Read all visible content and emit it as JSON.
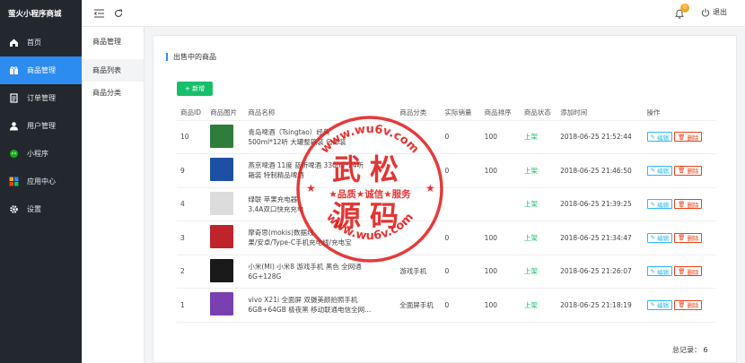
{
  "app": {
    "title": "萤火小程序商城"
  },
  "sidebar": {
    "items": [
      {
        "label": "首页",
        "icon": "home-icon"
      },
      {
        "label": "商品管理",
        "icon": "gift-icon"
      },
      {
        "label": "订单管理",
        "icon": "order-icon"
      },
      {
        "label": "用户管理",
        "icon": "user-icon"
      },
      {
        "label": "小程序",
        "icon": "wechat-icon"
      },
      {
        "label": "应用中心",
        "icon": "apps-icon"
      },
      {
        "label": "设置",
        "icon": "gear-icon"
      }
    ],
    "active_index": 1
  },
  "subnav": {
    "title": "商品管理",
    "items": [
      {
        "label": "商品列表"
      },
      {
        "label": "商品分类"
      }
    ]
  },
  "topbar": {
    "badge_count": "0",
    "logout_label": "退出"
  },
  "panel": {
    "title": "出售中的商品",
    "add_label": "+ 新增",
    "columns": [
      "商品ID",
      "商品图片",
      "商品名称",
      "商品分类",
      "实际销量",
      "商品排序",
      "商品状态",
      "添加时间",
      "操作"
    ],
    "edit_label": "编辑",
    "delete_label": "删除",
    "rows": [
      {
        "id": "10",
        "name1": "青岛啤酒（Tsingtao）经典",
        "name2": "500ml*12听 大罐整箱装 包邮装",
        "category": "",
        "sales": "0",
        "sort": "100",
        "status": "上架",
        "time": "2018-06-25 21:52:44",
        "thumb_color": "#2f7d3a"
      },
      {
        "id": "9",
        "name1": "燕京啤酒 11度 蓝听啤酒 330ml*24听",
        "name2": "箱装 特制精品啤酒",
        "category": "",
        "sales": "0",
        "sort": "100",
        "status": "上架",
        "time": "2018-06-25 21:46:50",
        "thumb_color": "#1d4fa3"
      },
      {
        "id": "4",
        "name1": "绿联 苹果充电器",
        "name2": "3.4A双口快充充电",
        "category": "",
        "sales": "",
        "sort": "",
        "status": "上架",
        "time": "2018-06-25 21:39:25",
        "thumb_color": "#dcdcdc"
      },
      {
        "id": "3",
        "name1": "摩奇思(mokis)数据线",
        "name2": "果/安卓/Type-C手机充电线/充电宝",
        "category": "",
        "sales": "0",
        "sort": "100",
        "status": "上架",
        "time": "2018-06-25 21:34:47",
        "thumb_color": "#c0242b"
      },
      {
        "id": "2",
        "name1": "小米(MI) 小米8 游戏手机 黑色 全网通",
        "name2": "6G+128G",
        "category": "游戏手机",
        "sales": "0",
        "sort": "100",
        "status": "上架",
        "time": "2018-06-25 21:26:07",
        "thumb_color": "#1a1a1a"
      },
      {
        "id": "1",
        "name1": "vivo X21i 全面屏 双摄美颜拍照手机",
        "name2": "6GB+64GB 极夜黑 移动联通电信全网...",
        "category": "全面屏手机",
        "sales": "0",
        "sort": "100",
        "status": "上架",
        "time": "2018-06-25 21:18:19",
        "thumb_color": "#7a3fb0"
      }
    ],
    "total_label": "总记录：",
    "total_value": "6"
  },
  "watermark": {
    "url_top": "www.wu6v.com",
    "big1": "武松",
    "slogan": "★品质★诚信★服务",
    "big2": "源码",
    "url_bottom": "www.wu6v.com",
    "color": "#e0201f"
  },
  "colors": {
    "sidebar_bg": "#22282e",
    "accent": "#2d8cf0",
    "success": "#19be6b",
    "danger": "#ed4014",
    "info": "#2db7f5"
  }
}
